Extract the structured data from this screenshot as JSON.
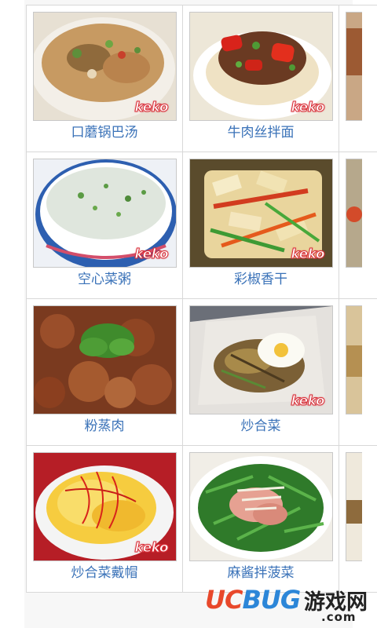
{
  "recipes": [
    {
      "name": "口蘑锅巴汤",
      "logo": "keko"
    },
    {
      "name": "牛肉丝拌面",
      "logo": "keko"
    },
    {
      "name": "空心菜粥",
      "logo": "keko"
    },
    {
      "name": "彩椒香干",
      "logo": "keko"
    },
    {
      "name": "粉蒸肉",
      "logo": ""
    },
    {
      "name": "炒合菜",
      "logo": "keko"
    },
    {
      "name": "炒合菜戴帽",
      "logo": "keko"
    },
    {
      "name": "麻酱拌菠菜",
      "logo": ""
    }
  ],
  "watermark": {
    "brand_uc": "UC",
    "brand_bug": "BUG",
    "brand_cn": "游戏网",
    "domain": ".com"
  },
  "colors": {
    "caption": "#3a72b8",
    "logo": "#d9303a"
  }
}
